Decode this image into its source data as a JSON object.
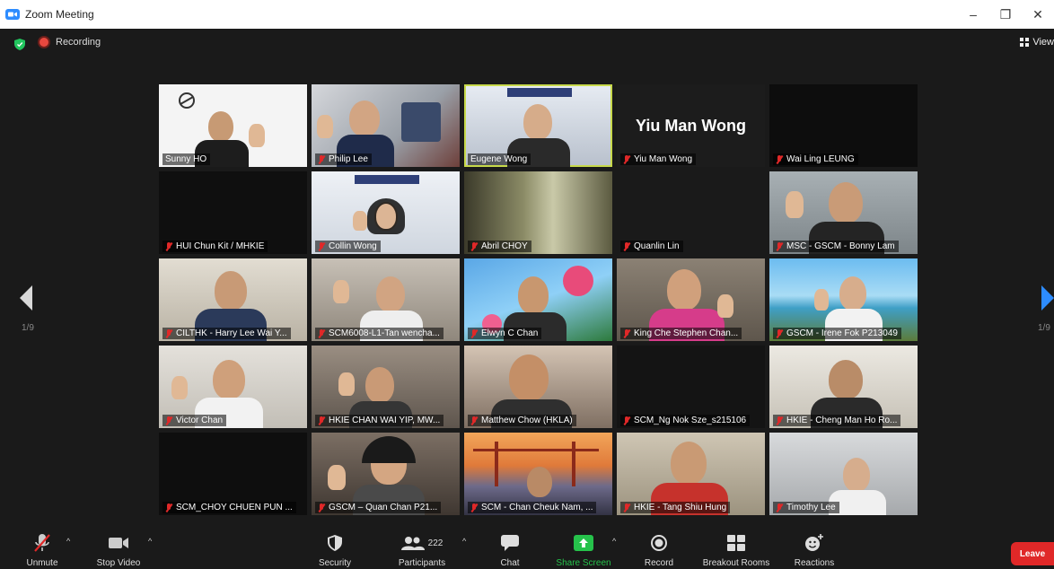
{
  "window": {
    "title": "Zoom Meeting",
    "minimize": "–",
    "maximize": "❐",
    "close": "✕"
  },
  "topbar": {
    "recording": "Recording",
    "view": "View"
  },
  "pages": {
    "left": "1/9",
    "right": "1/9"
  },
  "tiles": [
    {
      "name": "Sunny HO",
      "muted": false
    },
    {
      "name": "Philip Lee",
      "muted": true
    },
    {
      "name": "Eugene Wong",
      "muted": false,
      "active": true
    },
    {
      "name": "Yiu Man Wong",
      "muted": true,
      "big": "Yiu Man Wong"
    },
    {
      "name": "Wai Ling LEUNG",
      "muted": true
    },
    {
      "name": "HUI Chun Kit / MHKIE",
      "muted": true
    },
    {
      "name": "Collin Wong",
      "muted": true
    },
    {
      "name": "Abril CHOY",
      "muted": true
    },
    {
      "name": "Quanlin Lin",
      "muted": true
    },
    {
      "name": "MSC - GSCM - Bonny Lam",
      "muted": true
    },
    {
      "name": "CILTHK - Harry Lee Wai Y...",
      "muted": true
    },
    {
      "name": "SCM6008-L1-Tan wencha...",
      "muted": true
    },
    {
      "name": "Elwyn C Chan",
      "muted": true
    },
    {
      "name": "King Che Stephen Chan...",
      "muted": true
    },
    {
      "name": "GSCM - Irene Fok P213049",
      "muted": true
    },
    {
      "name": "Victor Chan",
      "muted": true
    },
    {
      "name": "HKIE CHAN WAI YIP, MW...",
      "muted": true
    },
    {
      "name": "Matthew Chow (HKLA)",
      "muted": true
    },
    {
      "name": "SCM_Ng Nok Sze_s215106",
      "muted": true
    },
    {
      "name": "HKIE - Cheng Man Ho Ro...",
      "muted": true
    },
    {
      "name": "SCM_CHOY CHUEN PUN ...",
      "muted": true
    },
    {
      "name": "GSCM – Quan Chan P21...",
      "muted": true
    },
    {
      "name": "SCM - Chan Cheuk Nam, ...",
      "muted": true
    },
    {
      "name": "HKIE - Tang Shiu Hung",
      "muted": true
    },
    {
      "name": "Timothy Lee",
      "muted": true
    }
  ],
  "toolbar": {
    "unmute": "Unmute",
    "stop_video": "Stop Video",
    "security": "Security",
    "participants": "Participants",
    "participants_count": "222",
    "chat": "Chat",
    "share_screen": "Share Screen",
    "record": "Record",
    "breakout_rooms": "Breakout Rooms",
    "reactions": "Reactions",
    "leave": "Leave"
  },
  "colors": {
    "share_green": "#26c24b",
    "leave_red": "#e02828",
    "active_speaker": "#c7d94a"
  }
}
